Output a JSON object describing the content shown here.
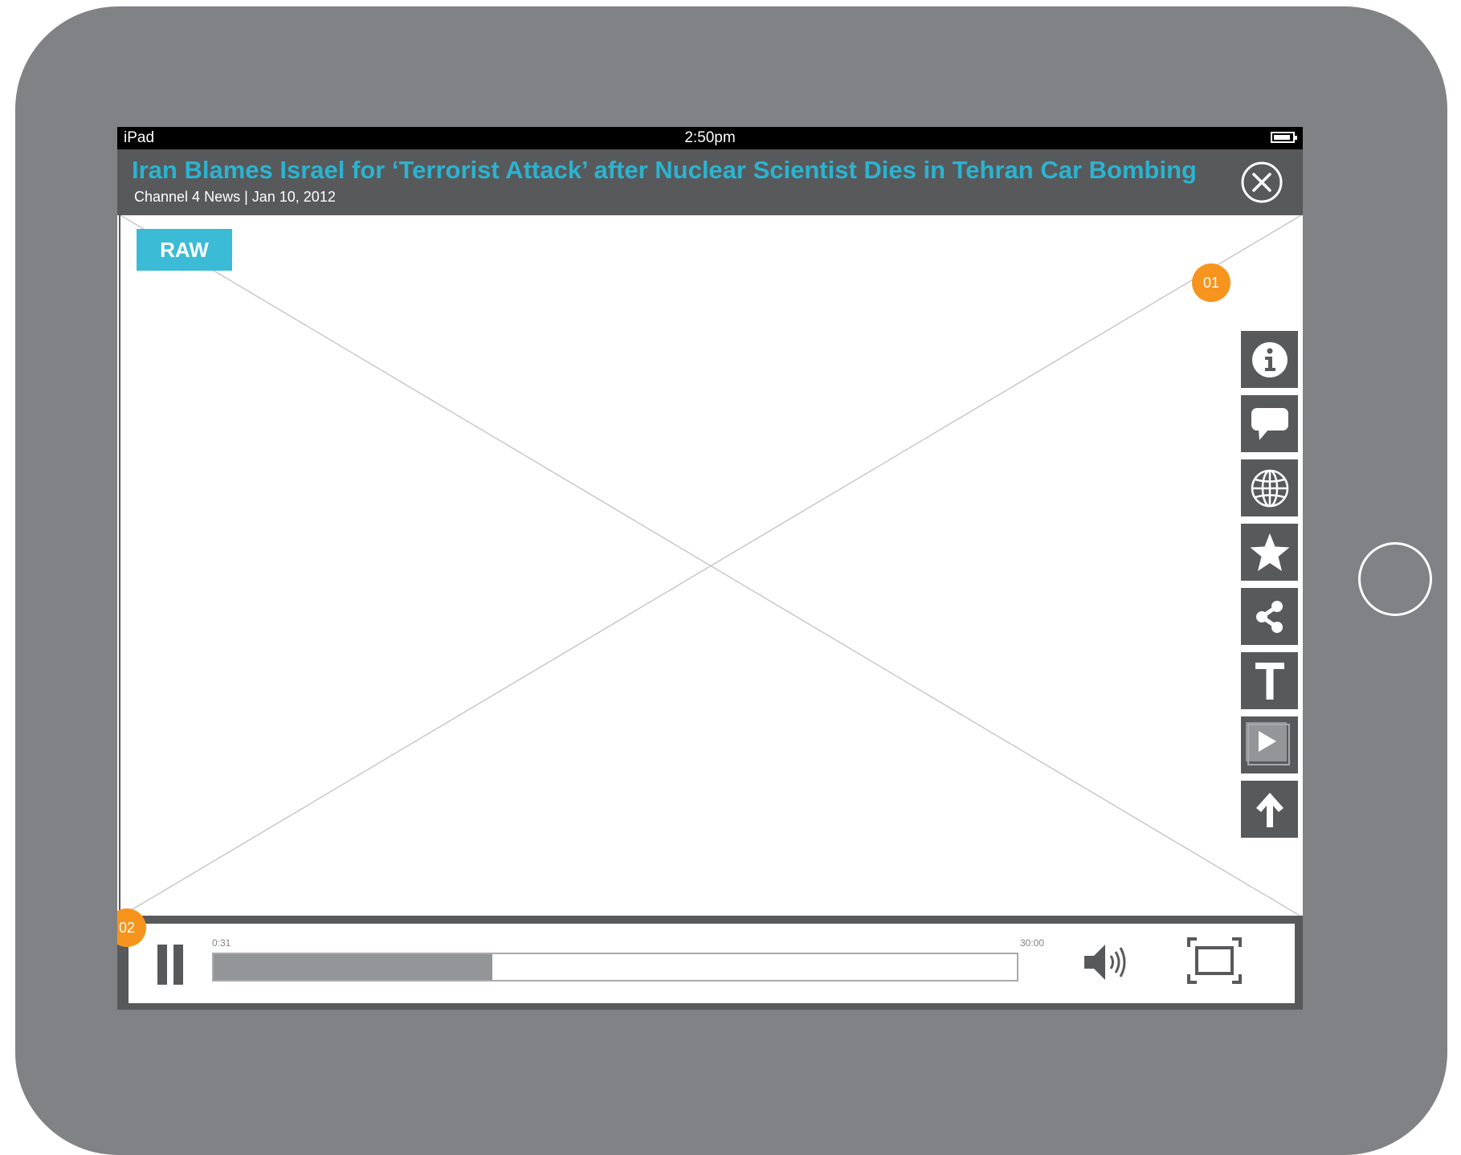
{
  "status_bar": {
    "device": "iPad",
    "time": "2:50pm",
    "battery_icon": "battery-icon"
  },
  "article": {
    "title": "Iran Blames Israel for ‘Terrorist Attack’ after Nuclear Scientist Dies in Tehran Car Bombing",
    "meta": "Channel 4 News | Jan 10, 2012",
    "close_icon": "close-icon"
  },
  "video": {
    "badge": "RAW"
  },
  "side_toolbar": {
    "items": [
      {
        "icon": "info-icon"
      },
      {
        "icon": "comment-icon"
      },
      {
        "icon": "globe-icon"
      },
      {
        "icon": "star-icon"
      },
      {
        "icon": "share-icon"
      },
      {
        "icon": "text-icon"
      },
      {
        "icon": "play-icon"
      },
      {
        "icon": "arrow-up-icon"
      }
    ]
  },
  "callouts": {
    "toolbar": "01",
    "player": "02"
  },
  "player": {
    "current_time": "0:31",
    "total_time": "30:00",
    "progress_fraction": 0.347,
    "pause_icon": "pause-icon",
    "volume_icon": "volume-icon",
    "fullscreen_icon": "fullscreen-icon"
  },
  "colors": {
    "accent": "#2bb3d0",
    "badge": "#3bbbd6",
    "callout": "#f7941d",
    "bar": "#58595b",
    "frame": "#818285"
  }
}
